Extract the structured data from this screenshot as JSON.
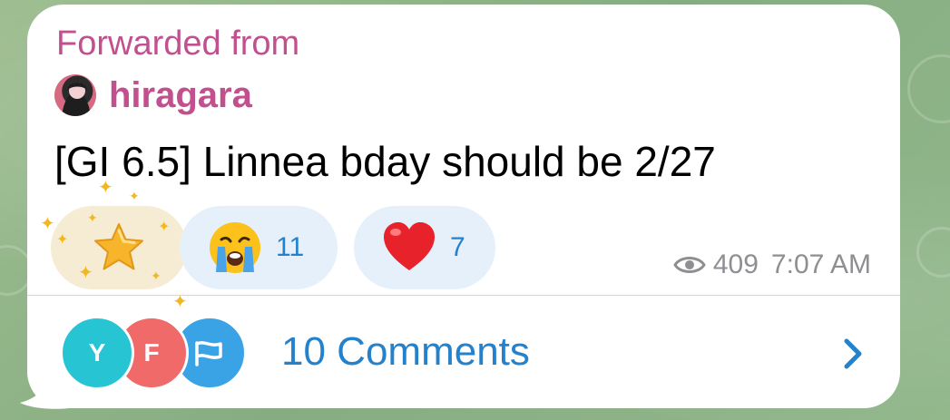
{
  "message": {
    "forwarded_label": "Forwarded from",
    "source_name": "hiragara",
    "text": "[GI 6.5] Linnea bday should be 2/27",
    "views": "409",
    "time": "7:07 AM"
  },
  "reactions": [
    {
      "emoji": "star",
      "count": ""
    },
    {
      "emoji": "crying-face",
      "count": "11"
    },
    {
      "emoji": "red-heart",
      "count": "7"
    }
  ],
  "comments": {
    "label": "10 Comments",
    "avatars": [
      {
        "initial": "Y",
        "color": "#27c4d3"
      },
      {
        "initial": "F",
        "color": "#f06a6a"
      },
      {
        "initial": "",
        "color": "#3aa3e6"
      }
    ]
  },
  "colors": {
    "accent": "#2481cc",
    "forward": "#c2508f",
    "meta": "#8e8e93"
  }
}
